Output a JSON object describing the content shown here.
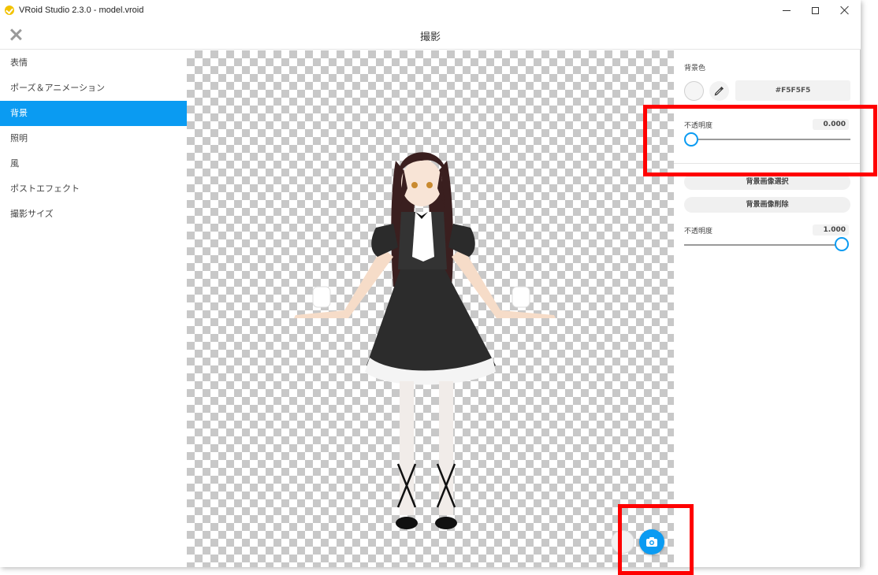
{
  "window": {
    "title": "VRoid Studio 2.3.0 - model.vroid"
  },
  "header": {
    "title": "撮影"
  },
  "sidebar": {
    "items": [
      {
        "label": "表情",
        "active": false
      },
      {
        "label": "ポーズ＆アニメーション",
        "active": false
      },
      {
        "label": "背景",
        "active": true
      },
      {
        "label": "照明",
        "active": false
      },
      {
        "label": "風",
        "active": false
      },
      {
        "label": "ポストエフェクト",
        "active": false
      },
      {
        "label": "撮影サイズ",
        "active": false
      }
    ]
  },
  "panel": {
    "bg_color_label": "背景色",
    "bg_color_hex": "#F5F5F5",
    "opacity1_label": "不透明度",
    "opacity1_value": "0.000",
    "select_bg_image": "背景画像選択",
    "delete_bg_image": "背景画像削除",
    "opacity2_label": "不透明度",
    "opacity2_value": "1.000"
  },
  "colors": {
    "accent": "#0a9bf2",
    "annotation": "#ff0000",
    "swatch": "#F5F5F5"
  },
  "icons": {
    "app": "vroid-logo-icon",
    "close": "close-icon",
    "eyedropper": "eyedropper-icon",
    "camera": "camera-icon"
  }
}
